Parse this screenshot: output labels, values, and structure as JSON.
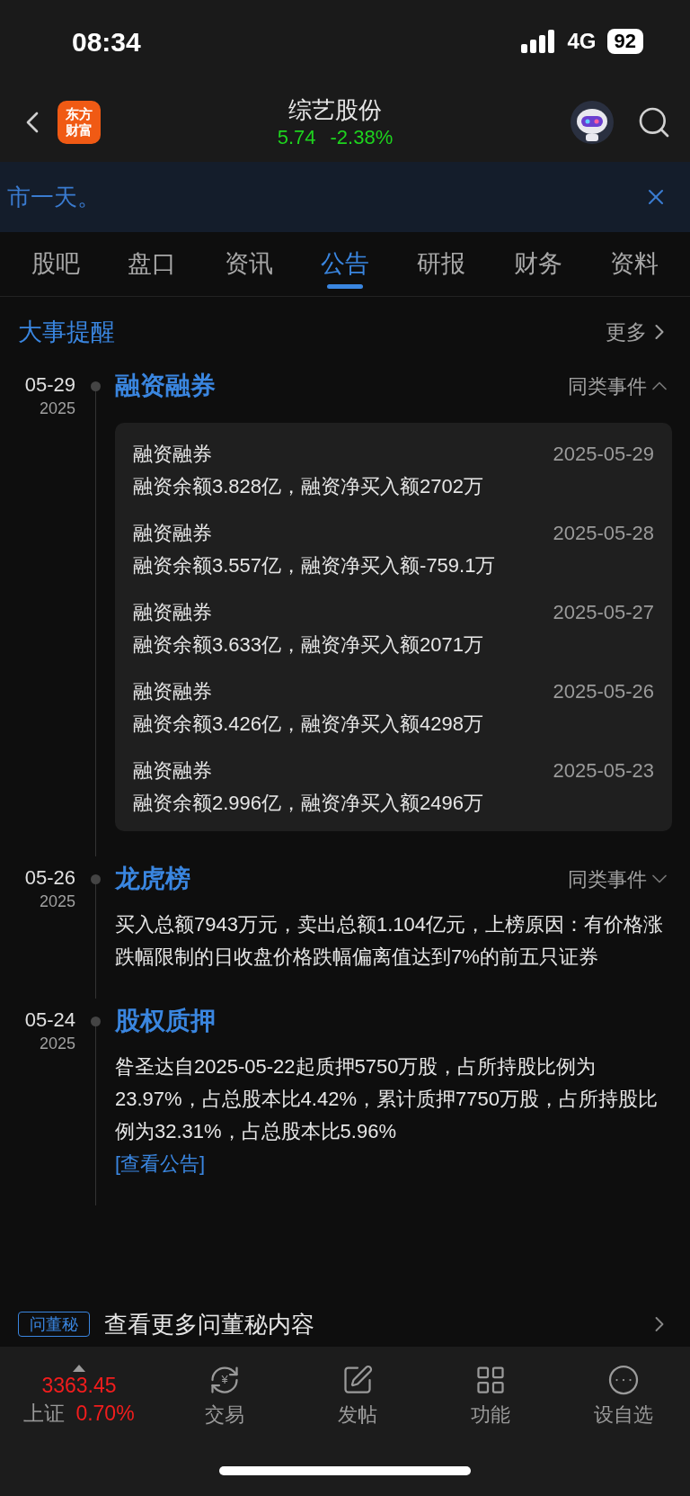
{
  "status_bar": {
    "time": "08:34",
    "network": "4G",
    "battery": "92"
  },
  "header": {
    "logo": "东方财富",
    "title": "综艺股份",
    "price": "5.74",
    "change": "-2.38%"
  },
  "banner": {
    "text": "市一天。"
  },
  "tabs": [
    {
      "label": "股吧",
      "selected": false
    },
    {
      "label": "盘口",
      "selected": false
    },
    {
      "label": "资讯",
      "selected": false
    },
    {
      "label": "公告",
      "selected": true
    },
    {
      "label": "研报",
      "selected": false
    },
    {
      "label": "财务",
      "selected": false
    },
    {
      "label": "资料",
      "selected": false
    }
  ],
  "section": {
    "title": "大事提醒",
    "more": "更多"
  },
  "events": [
    {
      "date": "05-29",
      "year": "2025",
      "title": "融资融券",
      "toggle": "同类事件",
      "expanded": true,
      "items": [
        {
          "title": "融资融券",
          "date": "2025-05-29",
          "text": "融资余额3.828亿，融资净买入额2702万"
        },
        {
          "title": "融资融券",
          "date": "2025-05-28",
          "text": "融资余额3.557亿，融资净买入额-759.1万"
        },
        {
          "title": "融资融券",
          "date": "2025-05-27",
          "text": "融资余额3.633亿，融资净买入额2071万"
        },
        {
          "title": "融资融券",
          "date": "2025-05-26",
          "text": "融资余额3.426亿，融资净买入额4298万"
        },
        {
          "title": "融资融券",
          "date": "2025-05-23",
          "text": "融资余额2.996亿，融资净买入额2496万"
        }
      ]
    },
    {
      "date": "05-26",
      "year": "2025",
      "title": "龙虎榜",
      "toggle": "同类事件",
      "expanded": false,
      "text": "买入总额7943万元，卖出总额1.104亿元，上榜原因：有价格涨跌幅限制的日收盘价格跌幅偏离值达到7%的前五只证券"
    },
    {
      "date": "05-24",
      "year": "2025",
      "title": "股权质押",
      "text": "昝圣达自2025-05-22起质押5750万股，占所持股比例为23.97%，占总股本比4.42%，累计质押7750万股，占所持股比例为32.31%，占总股本比5.96%",
      "link": "[查看公告]"
    }
  ],
  "qa": {
    "tag": "问董秘",
    "text": "查看更多问董秘内容"
  },
  "bottom_bar": {
    "index": {
      "value": "3363.45",
      "name": "上证",
      "change": "0.70%"
    },
    "items": [
      {
        "kind": "trade",
        "symbol": "¥",
        "label": "交易"
      },
      {
        "kind": "post",
        "label": "发帖"
      },
      {
        "kind": "functions",
        "label": "功能"
      },
      {
        "kind": "more",
        "label": "设自选"
      }
    ]
  }
}
